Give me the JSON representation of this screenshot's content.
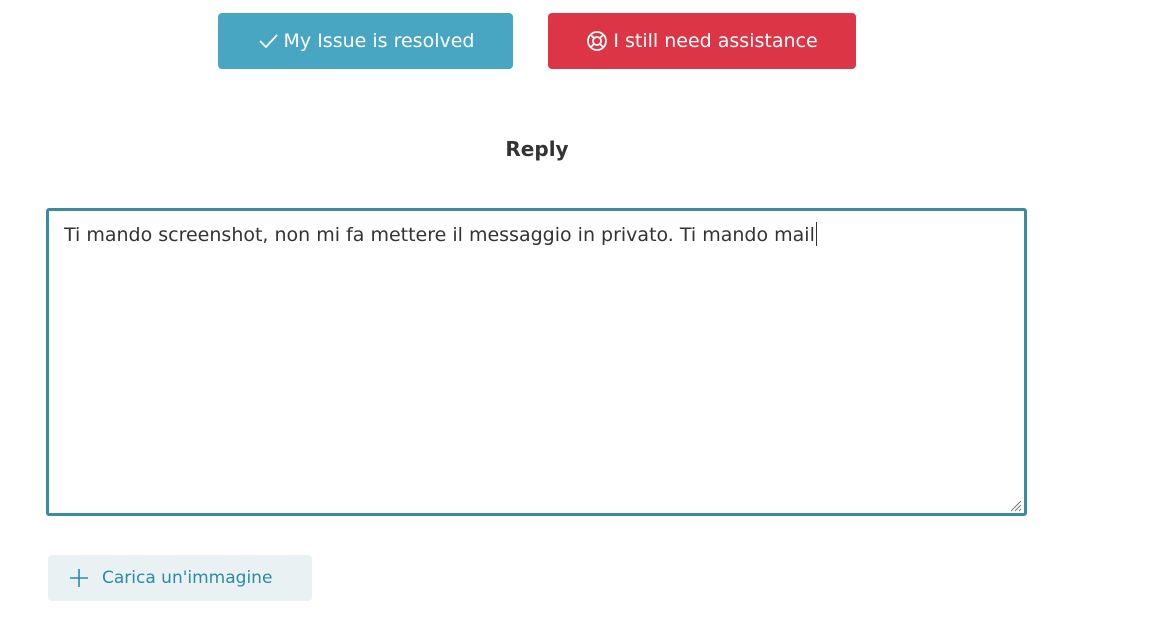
{
  "actions": {
    "resolved_label": "My Issue is resolved",
    "resolved_icon": "checkmark-icon",
    "resolved_color": "#48a6c2",
    "assist_label": "I still need assistance",
    "assist_icon": "lifebuoy-icon",
    "assist_color": "#dc3545"
  },
  "reply": {
    "heading": "Reply",
    "text": "Ti mando screenshot, non mi fa mettere il messaggio in privato. Ti mando mail",
    "border_color": "#3a8b9d"
  },
  "upload": {
    "label": "Carica un'immagine",
    "icon": "plus-icon",
    "text_color": "#2d8aa3"
  }
}
